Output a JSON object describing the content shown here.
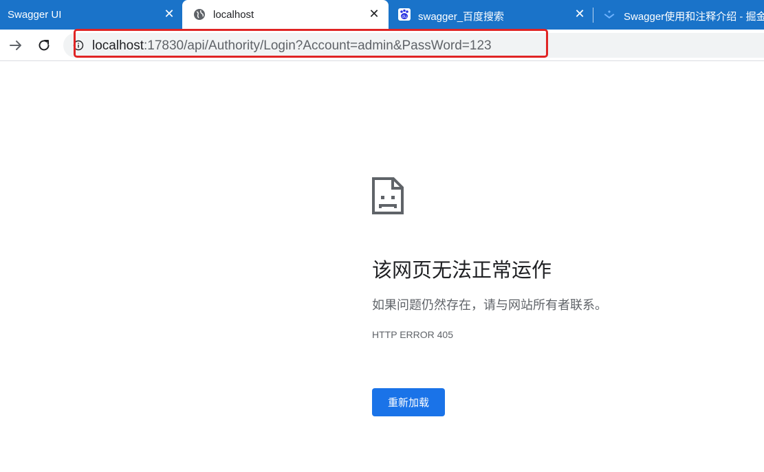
{
  "tabs": [
    {
      "title": "Swagger UI",
      "close": "✕",
      "active": false,
      "icon": "none"
    },
    {
      "title": "localhost",
      "close": "✕",
      "active": true,
      "icon": "globe-icon"
    },
    {
      "title": "swagger_百度搜索",
      "close": "✕",
      "active": false,
      "icon": "baidu-paw-icon"
    },
    {
      "title": "Swagger使用和注释介绍 - 掘金",
      "close": "",
      "active": false,
      "icon": "juejin-icon"
    }
  ],
  "toolbar": {
    "forward_icon": "forward-arrow-icon",
    "reload_icon": "reload-icon"
  },
  "omnibox": {
    "info_icon": "info-icon",
    "host": "localhost",
    "path": ":17830/api/Authority/Login?Account=admin&PassWord=123",
    "highlight_color": "#e02424"
  },
  "error": {
    "icon": "sad-page-icon",
    "title": "该网页无法正常运作",
    "message": "如果问题仍然存在，请与网站所有者联系。",
    "code": "HTTP ERROR 405",
    "reload_label": "重新加载"
  },
  "colors": {
    "tabstrip": "#1a73c9",
    "button": "#1a73e8"
  }
}
